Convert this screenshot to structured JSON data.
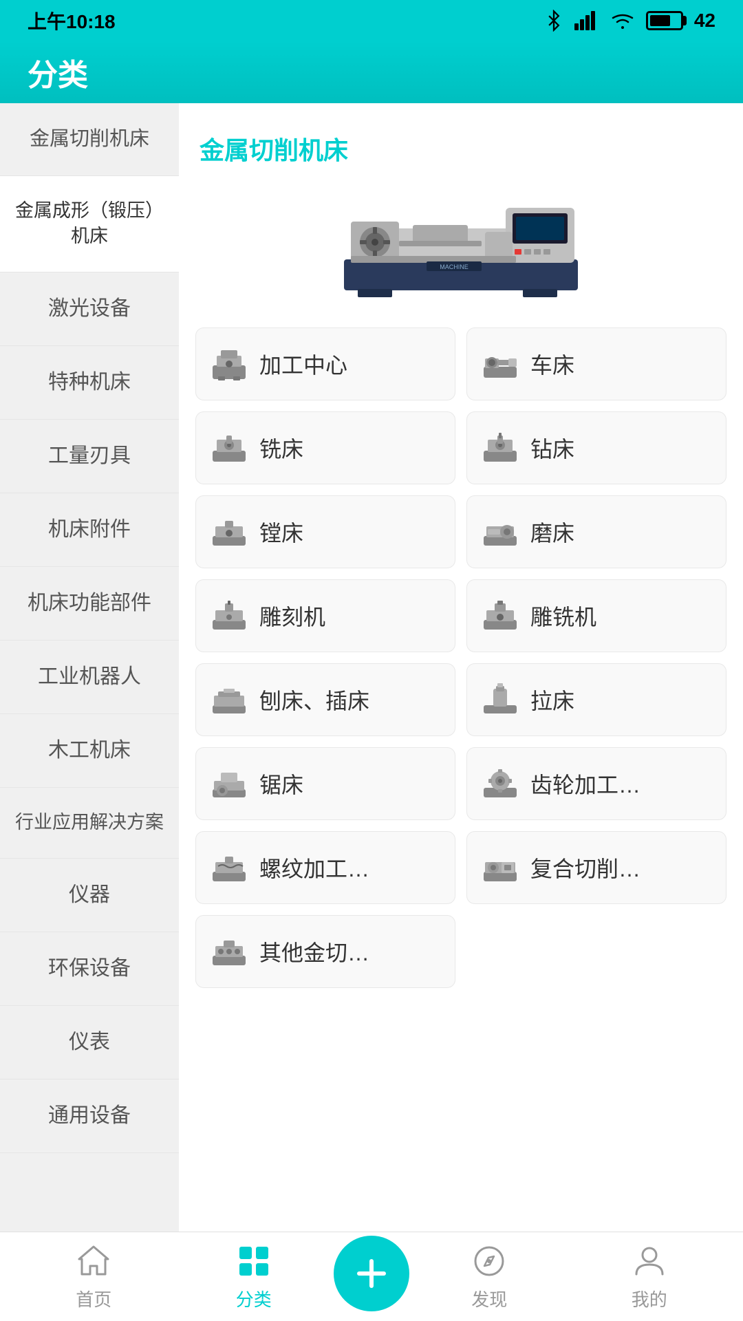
{
  "statusBar": {
    "time": "上午10:18",
    "battery": "42"
  },
  "header": {
    "title": "分类"
  },
  "sidebar": {
    "items": [
      {
        "id": "metal-cutting",
        "label": "金属切削机床",
        "active": false
      },
      {
        "id": "metal-forming",
        "label": "金属成形（锻压）机床",
        "active": true
      },
      {
        "id": "laser",
        "label": "激光设备",
        "active": false
      },
      {
        "id": "special",
        "label": "特种机床",
        "active": false
      },
      {
        "id": "tools",
        "label": "工量刃具",
        "active": false
      },
      {
        "id": "accessories",
        "label": "机床附件",
        "active": false
      },
      {
        "id": "functional",
        "label": "机床功能部件",
        "active": false
      },
      {
        "id": "robot",
        "label": "工业机器人",
        "active": false
      },
      {
        "id": "woodworking",
        "label": "木工机床",
        "active": false
      },
      {
        "id": "industry",
        "label": "行业应用解决方案",
        "active": false
      },
      {
        "id": "instrument",
        "label": "仪器",
        "active": false
      },
      {
        "id": "env",
        "label": "环保设备",
        "active": false
      },
      {
        "id": "meter",
        "label": "仪表",
        "active": false
      },
      {
        "id": "general",
        "label": "通用设备",
        "active": false
      }
    ]
  },
  "categorySection": {
    "title": "金属切削机床",
    "gridItems": [
      {
        "id": "machining-center",
        "label": "加工中心"
      },
      {
        "id": "lathe",
        "label": "车床"
      },
      {
        "id": "milling",
        "label": "铣床"
      },
      {
        "id": "drilling",
        "label": "钻床"
      },
      {
        "id": "boring",
        "label": "镗床"
      },
      {
        "id": "grinding",
        "label": "磨床"
      },
      {
        "id": "engraving",
        "label": "雕刻机"
      },
      {
        "id": "engraving-milling",
        "label": "雕铣机"
      },
      {
        "id": "planing",
        "label": "刨床、插床"
      },
      {
        "id": "broaching",
        "label": "拉床"
      },
      {
        "id": "sawing",
        "label": "锯床"
      },
      {
        "id": "gear",
        "label": "齿轮加工…"
      },
      {
        "id": "thread",
        "label": "螺纹加工…"
      },
      {
        "id": "compound",
        "label": "复合切削…"
      },
      {
        "id": "other",
        "label": "其他金切…",
        "single": true
      }
    ]
  },
  "bottomNav": {
    "items": [
      {
        "id": "home",
        "label": "首页",
        "active": false,
        "icon": "home-icon"
      },
      {
        "id": "category",
        "label": "分类",
        "active": true,
        "icon": "category-icon"
      },
      {
        "id": "add",
        "label": "",
        "active": false,
        "icon": "add-icon",
        "isAdd": true
      },
      {
        "id": "discover",
        "label": "发现",
        "active": false,
        "icon": "discover-icon"
      },
      {
        "id": "mine",
        "label": "我的",
        "active": false,
        "icon": "mine-icon"
      }
    ]
  }
}
